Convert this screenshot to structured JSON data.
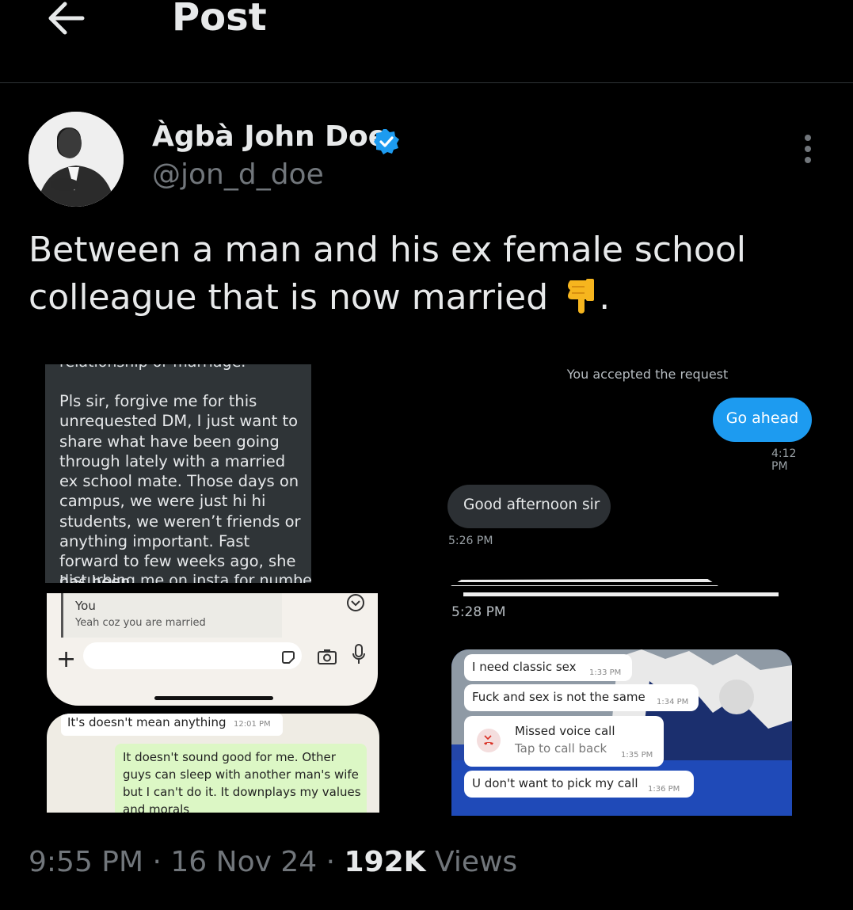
{
  "header": {
    "title": "Post"
  },
  "author": {
    "name": "Àgbà John Doe",
    "handle": "@jon_d_doe",
    "verified": true
  },
  "post": {
    "text": "Between a man and his ex female school colleague that is now married",
    "emoji": "backhand-index-pointing-down",
    "trailing": "."
  },
  "image_left": {
    "dm_cut_top": "relationship or marriage.",
    "dm_text": "Pls sir, forgive me for this unrequested DM, I just want to share what have been going through lately with a married ex school mate.  Those days on campus, we were just hi hi students, we weren’t friends or anything important.  Fast forward to few weeks ago, she has been",
    "dm_cut_bottom": "disturbing me on insta for number",
    "wa_reply_sender": "You",
    "wa_reply_quote": "Yeah coz you are married",
    "wa_in_text": "It's doesn't mean anything",
    "wa_in_time": "12:01 PM",
    "wa_out_text": "It doesn't sound good for me. Other guys can sleep with another man's wife but I can't do it.  It downplays my values and morals"
  },
  "image_right": {
    "accepted": "You accepted the request",
    "go_ahead": "Go ahead",
    "go_ahead_time": "4:12 PM",
    "good_afternoon": "Good afternoon sir",
    "good_afternoon_time": "5:26 PM",
    "time_528": "5:28 PM",
    "ig_messages": [
      {
        "text": "I need classic sex",
        "time": "1:33 PM"
      },
      {
        "text": "Fuck and sex is not the same",
        "time": "1:34 PM"
      },
      {
        "title": "Missed voice call",
        "subtitle": "Tap to call back",
        "time": "1:35 PM"
      },
      {
        "text": "U don't want to pick my call",
        "time": "1:36 PM"
      }
    ]
  },
  "footer": {
    "time": "9:55 PM",
    "sep1": " · ",
    "date": "16 Nov 24",
    "sep2": " · ",
    "views_count": "192K",
    "views_label": " Views"
  },
  "colors": {
    "background": "#000000",
    "text": "#e7e9ea",
    "muted": "#71767b",
    "accent": "#1d9bf0"
  }
}
